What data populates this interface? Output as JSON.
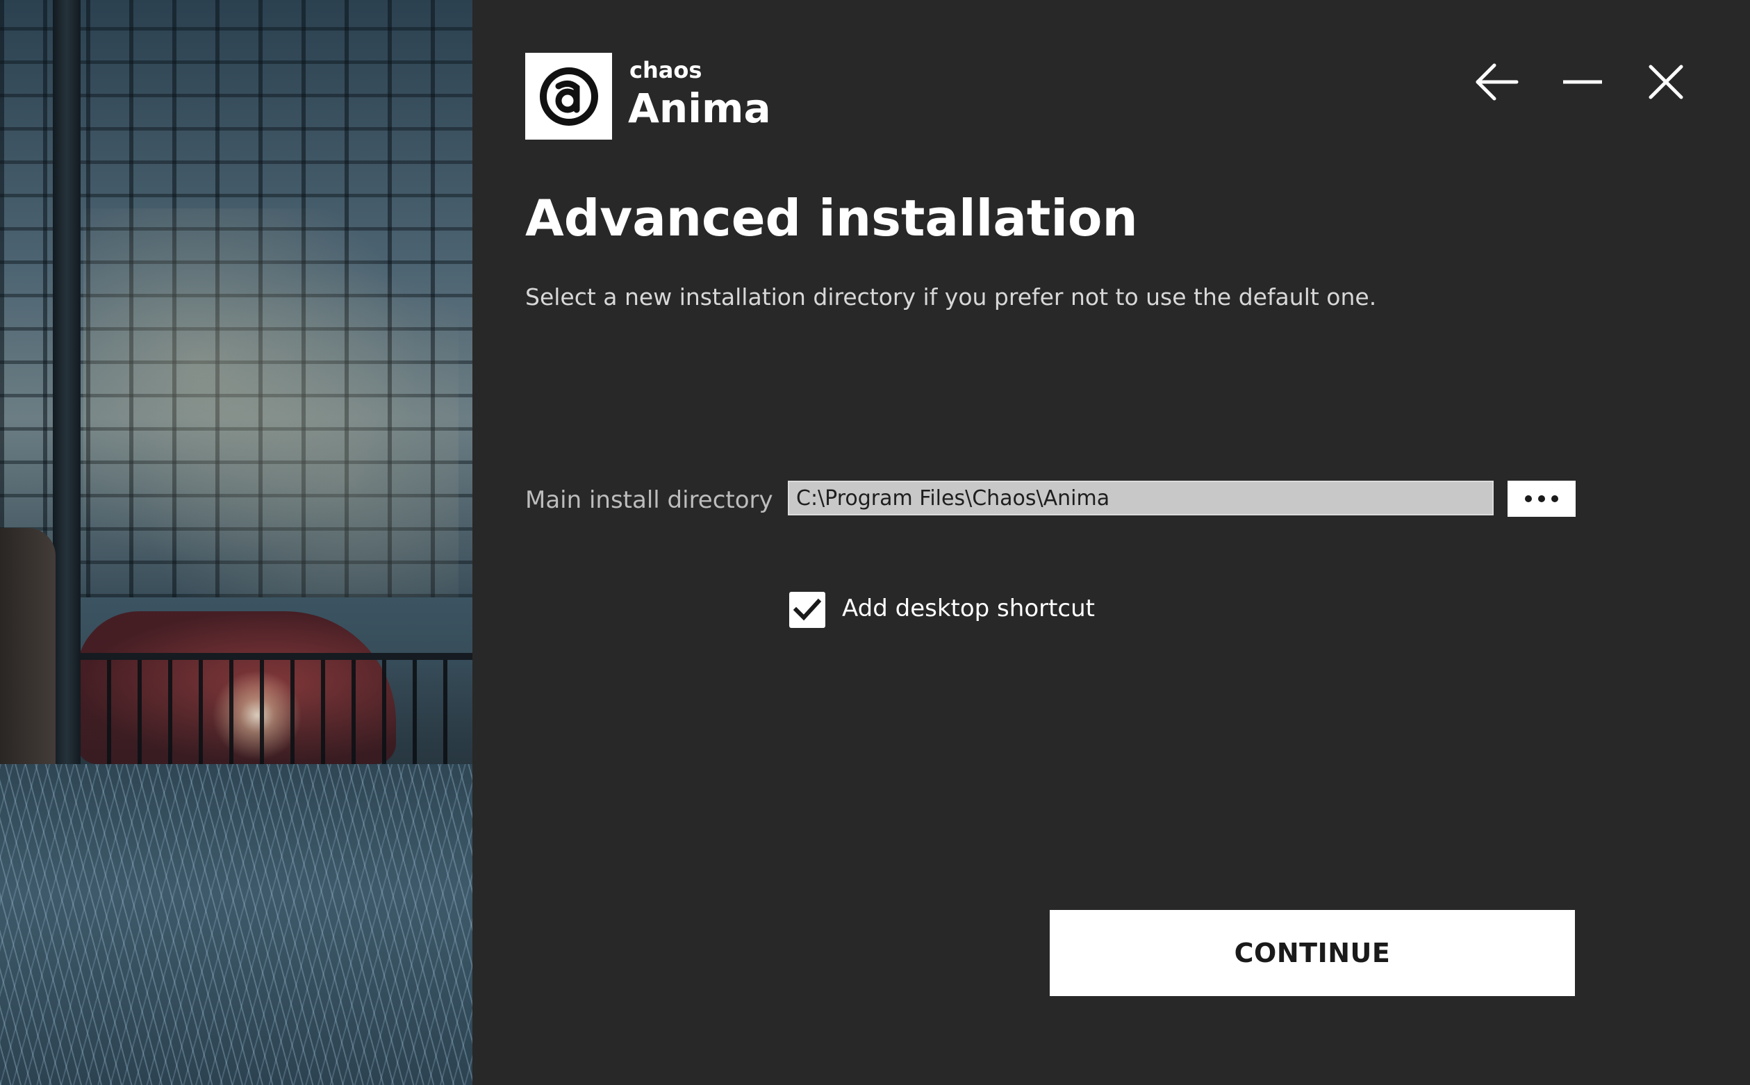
{
  "window": {
    "back_icon": "arrow-left-icon",
    "minimize_icon": "minimize-icon",
    "close_icon": "close-icon"
  },
  "brand": {
    "company": "chaos",
    "product": "Anima",
    "logo_icon": "anima-logo-icon"
  },
  "page": {
    "title": "Advanced installation",
    "subtitle": "Select a new installation directory if you prefer not to use the default one."
  },
  "form": {
    "dir_label": "Main install directory",
    "dir_value": "C:\\Program Files\\Chaos\\Anima",
    "browse_icon": "more-horizontal-icon",
    "shortcut_label": "Add desktop shortcut",
    "shortcut_checked": true
  },
  "actions": {
    "continue_label": "CONTINUE"
  },
  "colors": {
    "panel_bg": "#282828",
    "text_primary": "#ffffff",
    "input_bg": "#c8c8c8",
    "button_bg": "#ffffff"
  }
}
